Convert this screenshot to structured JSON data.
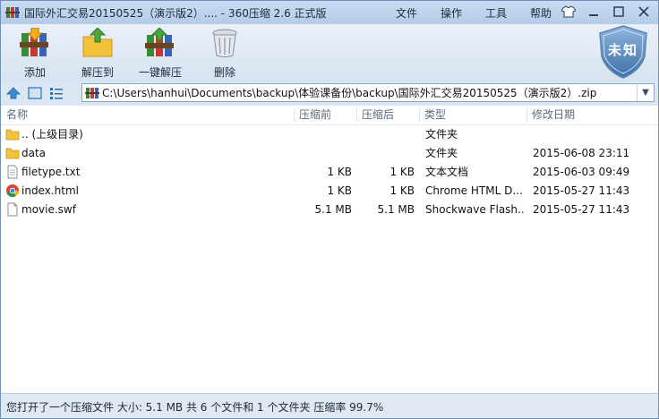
{
  "window": {
    "title": "国际外汇交易20150525（演示版2）.... - 360压缩 2.6 正式版",
    "menu": [
      "文件",
      "操作",
      "工具",
      "帮助"
    ]
  },
  "toolbar": {
    "add_label": "添加",
    "extract_to_label": "解压到",
    "one_click_extract_label": "一键解压",
    "delete_label": "删除",
    "security_status": "未知"
  },
  "address": {
    "path": "C:\\Users\\hanhui\\Documents\\backup\\体验课备份\\backup\\国际外汇交易20150525（演示版2）.zip"
  },
  "list": {
    "columns": [
      "名称",
      "压缩前",
      "压缩后",
      "类型",
      "修改日期"
    ],
    "rows": [
      {
        "name": ".. (上级目录)",
        "before": "",
        "after": "",
        "type": "文件夹",
        "date": "",
        "icon": "folder-up-icon"
      },
      {
        "name": "data",
        "before": "",
        "after": "",
        "type": "文件夹",
        "date": "2015-06-08 23:11",
        "icon": "folder-icon"
      },
      {
        "name": "filetype.txt",
        "before": "1 KB",
        "after": "1 KB",
        "type": "文本文档",
        "date": "2015-06-03 09:49",
        "icon": "text-file-icon"
      },
      {
        "name": "index.html",
        "before": "1 KB",
        "after": "1 KB",
        "type": "Chrome HTML D...",
        "date": "2015-05-27 11:43",
        "icon": "chrome-icon"
      },
      {
        "name": "movie.swf",
        "before": "5.1 MB",
        "after": "5.1 MB",
        "type": "Shockwave Flash...",
        "date": "2015-05-27 11:43",
        "icon": "file-icon"
      }
    ]
  },
  "status": {
    "text": "您打开了一个压缩文件 大小: 5.1 MB 共 6 个文件和 1 个文件夹 压缩率 99.7%"
  },
  "colors": {
    "accent": "#3a78c4",
    "background": "#dfe8f3"
  }
}
